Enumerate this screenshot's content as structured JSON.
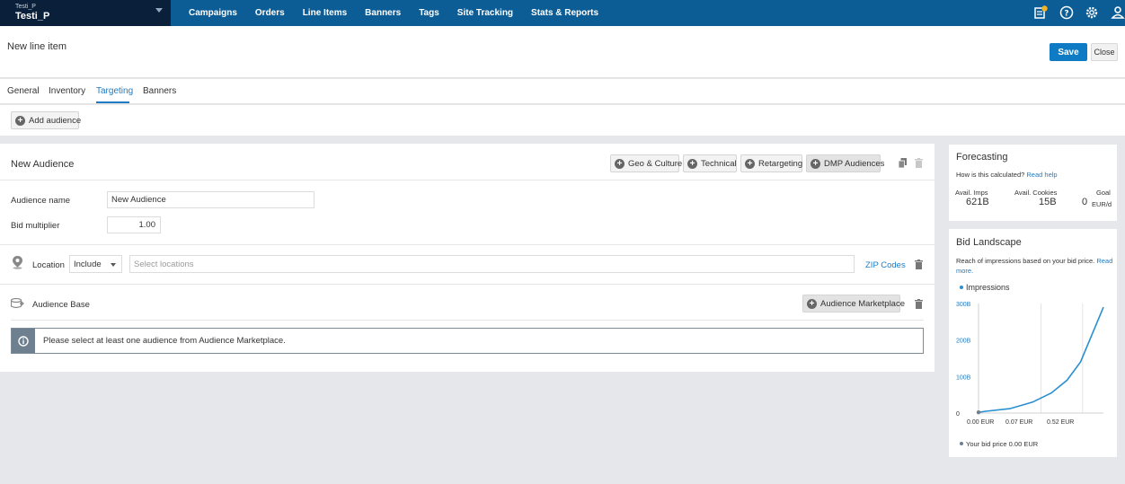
{
  "account": {
    "small": "Testi_P",
    "name": "Testi_P"
  },
  "nav": [
    "Campaigns",
    "Orders",
    "Line Items",
    "Banners",
    "Tags",
    "Site Tracking",
    "Stats & Reports"
  ],
  "header": {
    "title": "New line item",
    "save": "Save",
    "close": "Close"
  },
  "tabs": [
    "General",
    "Inventory",
    "Targeting",
    "Banners"
  ],
  "add_audience": "Add audience",
  "audience": {
    "title": "New Audience",
    "buttons": [
      "Geo & Culture",
      "Technical",
      "Retargeting",
      "DMP Audiences"
    ],
    "name_label": "Audience name",
    "name_value": "New Audience",
    "bid_label": "Bid multiplier",
    "bid_value": "1.00",
    "location_label": "Location",
    "include": "Include",
    "locations_placeholder": "Select locations",
    "zip_codes": "ZIP Codes",
    "base_label": "Audience Base",
    "marketplace": "Audience Marketplace",
    "info": "Please select at least one audience from Audience Marketplace."
  },
  "forecasting": {
    "title": "Forecasting",
    "question": "How is this calculated?",
    "read_help": "Read help",
    "imps_label": "Avail. Imps",
    "imps_value": "621B",
    "cookies_label": "Avail. Cookies",
    "cookies_value": "15B",
    "goal_label": "Goal",
    "goal_value": "0",
    "goal_unit": "EUR/d"
  },
  "bid_landscape": {
    "title": "Bid Landscape",
    "desc": "Reach of impressions based on your bid price.",
    "read_more": "Read more.",
    "legend": "Impressions",
    "your_bid": "Your bid price 0.00 EUR"
  },
  "colors": {
    "nav": "#0c5d96",
    "account": "#0a1f3a",
    "accent": "#1f7bc2",
    "curve": "#2a8fd0"
  },
  "chart_data": {
    "type": "line",
    "series": [
      {
        "name": "Impressions",
        "x": [
          0,
          0.07,
          0.3,
          0.52,
          0.7,
          0.85,
          0.98,
          1.2
        ],
        "y": [
          2,
          5,
          12,
          30,
          55,
          90,
          140,
          290
        ]
      }
    ],
    "x_ticks": [
      "0.00 EUR",
      "0.07 EUR",
      "0.52 EUR"
    ],
    "y_ticks": [
      "0",
      "100B",
      "200B",
      "300B"
    ],
    "ylim": [
      0,
      300
    ],
    "grid": true
  }
}
